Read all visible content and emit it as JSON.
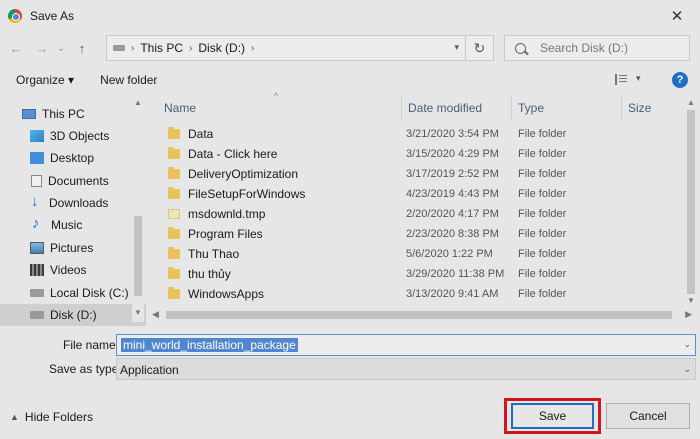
{
  "window": {
    "title": "Save As",
    "app_icon": "chrome-icon",
    "close_glyph": "✕"
  },
  "navbar": {
    "back_glyph": "←",
    "forward_glyph": "→",
    "recent_glyph": "⌄",
    "up_glyph": "↑",
    "breadcrumb": [
      "This PC",
      "Disk (D:)"
    ],
    "sep_glyph": "›",
    "refresh_glyph": "↻",
    "search_placeholder": "Search Disk (D:)"
  },
  "commands": {
    "organize": "Organize ▾",
    "new_folder": "New folder",
    "help": "?"
  },
  "nav_pane": {
    "items": [
      {
        "label": "This PC",
        "icon": "computer-icon"
      },
      {
        "label": "3D Objects",
        "icon": "3d-objects-icon"
      },
      {
        "label": "Desktop",
        "icon": "desktop-icon"
      },
      {
        "label": "Documents",
        "icon": "documents-icon"
      },
      {
        "label": "Downloads",
        "icon": "downloads-icon"
      },
      {
        "label": "Music",
        "icon": "music-icon"
      },
      {
        "label": "Pictures",
        "icon": "pictures-icon"
      },
      {
        "label": "Videos",
        "icon": "videos-icon"
      },
      {
        "label": "Local Disk (C:)",
        "icon": "drive-icon"
      },
      {
        "label": "Disk (D:)",
        "icon": "drive-icon",
        "selected": true
      }
    ]
  },
  "files": {
    "columns": [
      "Name",
      "Date modified",
      "Type",
      "Size"
    ],
    "rows": [
      {
        "name": "Data",
        "date": "3/21/2020 3:54 PM",
        "type": "File folder",
        "icon": "folder-icon"
      },
      {
        "name": "Data - Click here",
        "date": "3/15/2020 4:29 PM",
        "type": "File folder",
        "icon": "folder-icon"
      },
      {
        "name": "DeliveryOptimization",
        "date": "3/17/2019 2:52 PM",
        "type": "File folder",
        "icon": "folder-icon"
      },
      {
        "name": "FileSetupForWindows",
        "date": "4/23/2019 4:43 PM",
        "type": "File folder",
        "icon": "folder-icon"
      },
      {
        "name": "msdownld.tmp",
        "date": "2/20/2020 4:17 PM",
        "type": "File folder",
        "icon": "tmp-folder-icon"
      },
      {
        "name": "Program Files",
        "date": "2/23/2020 8:38 PM",
        "type": "File folder",
        "icon": "folder-icon"
      },
      {
        "name": "Thu Thao",
        "date": "5/6/2020 1:22 PM",
        "type": "File folder",
        "icon": "folder-icon"
      },
      {
        "name": "thu thủy",
        "date": "3/29/2020 11:38 PM",
        "type": "File folder",
        "icon": "folder-icon"
      },
      {
        "name": "WindowsApps",
        "date": "3/13/2020 9:41 AM",
        "type": "File folder",
        "icon": "folder-icon"
      }
    ]
  },
  "form": {
    "file_name_label": "File name:",
    "file_name_value": "mini_world_installation_package",
    "save_type_label": "Save as type:",
    "save_type_value": "Application"
  },
  "footer": {
    "hide_folders": "Hide Folders",
    "save": "Save",
    "cancel": "Cancel",
    "highlight_color": "#d4151b"
  }
}
